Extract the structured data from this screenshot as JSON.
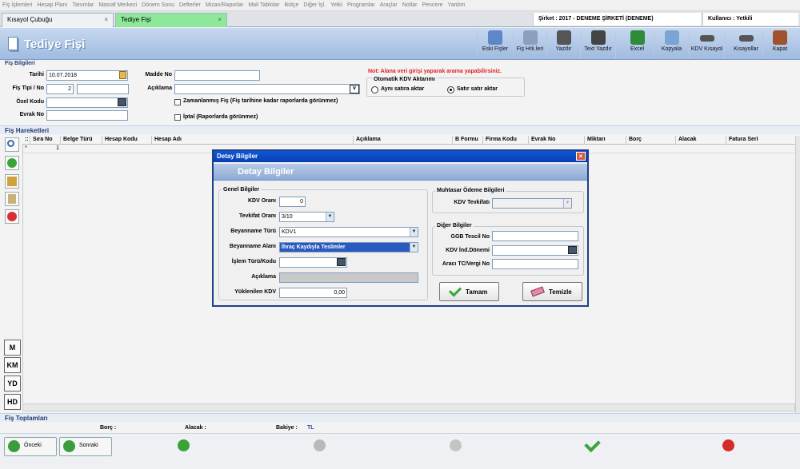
{
  "menu": [
    "Fiş İşlemleri",
    "Hesap Planı",
    "Tanımlar",
    "Masraf Merkezi",
    "Dönem Sonu",
    "Defterler",
    "Mizan/Raporlar",
    "Mali Tablolar",
    "Bütçe",
    "Diğer İşl.",
    "Yetki",
    "Programlar",
    "Araçlar",
    "Notlar",
    "Pencere",
    "Yardım"
  ],
  "tabs": {
    "tab1": "Kısayol Çubuğu",
    "tab2": "Tediye Fişi",
    "close": "×"
  },
  "info": {
    "company": "Şirket : 2017 - DENEME ŞİRKETİ (DENEME)",
    "user": "Kullanıcı : Yetkili"
  },
  "page_title": "Tediye Fişi",
  "toolbar": [
    "Eski Fişler",
    "Fiş Hrk.leri",
    "Yazdır",
    "Text Yazdır",
    "Excel",
    "Kopyala",
    "KDV Kısayol",
    "Kısayollar",
    "Kapat"
  ],
  "fis": {
    "section": "Fiş Bilgileri",
    "tarih_label": "Tarihi",
    "tarih": "10.07.2018",
    "tip_label": "Fiş Tipi / No",
    "tip": "2",
    "ozel_label": "Özel Kodu",
    "evrak_label": "Evrak No",
    "madde_label": "Madde No",
    "aciklama_label": "Açıklama",
    "zaman_label": "Zamanlanmış Fiş (Fiş tarihine kadar raporlarda görünmez)",
    "iptal_label": "İptal (Raporlarda görünmez)",
    "note": "Not: Alana veri girişi yaparak arama yapabilirsiniz.",
    "kdv_title": "Otomatik KDV Aktarımı",
    "radio1": "Aynı satıra aktar",
    "radio2": "Satır satır aktar"
  },
  "hareket": {
    "section": "Fiş Hareketleri",
    "columns": [
      "Sıra No",
      "Belge Türü",
      "Hesap Kodu",
      "Hesap Adı",
      "Açıklama",
      "B Formu",
      "Firma Kodu",
      "Evrak No",
      "Miktarı",
      "Borç",
      "Alacak",
      "Fatura Seri"
    ],
    "row_marker": "*",
    "row_no": "1"
  },
  "side_buttons": [
    "M",
    "KM",
    "YD",
    "HD"
  ],
  "totals": {
    "section": "Fiş Toplamları",
    "borc": "Borç :",
    "alacak": "Alacak :",
    "bakiye": "Bakiye :",
    "tl": "TL"
  },
  "nav": {
    "prev": "Önceki",
    "next": "Sonraki"
  },
  "dialog": {
    "title": "Detay Bilgiler",
    "band": "Detay Bilgiler",
    "genel": "Genel Bilgiler",
    "kdv_orani_label": "KDV Oranı",
    "kdv_orani": "0",
    "tevkifat_label": "Tevkifat Oranı",
    "tevkifat": "3/10",
    "beyan_turu_label": "Beyanname Türü",
    "beyan_turu": "KDV1",
    "beyan_alani_label": "Beyanname Alanı",
    "beyan_alani": "İhraç Kaydıyla Teslimler",
    "islem_label": "İşlem Türü/Kodu",
    "aciklama_label": "Açıklama",
    "yuklenilen_label": "Yüklenilen KDV",
    "yuklenilen": "0,00",
    "muhtasar": "Muhtasar Ödeme Bilgileri",
    "kdv_tevkifati_label": "KDV Tevkifatı",
    "diger": "Diğer Bilgiler",
    "ggb_label": "GGB Tescil No",
    "kdv_ind_label": "KDV İnd.Dönemi",
    "araci_label": "Aracı TC/Vergi No",
    "ok": "Tamam",
    "clear": "Temizle"
  }
}
